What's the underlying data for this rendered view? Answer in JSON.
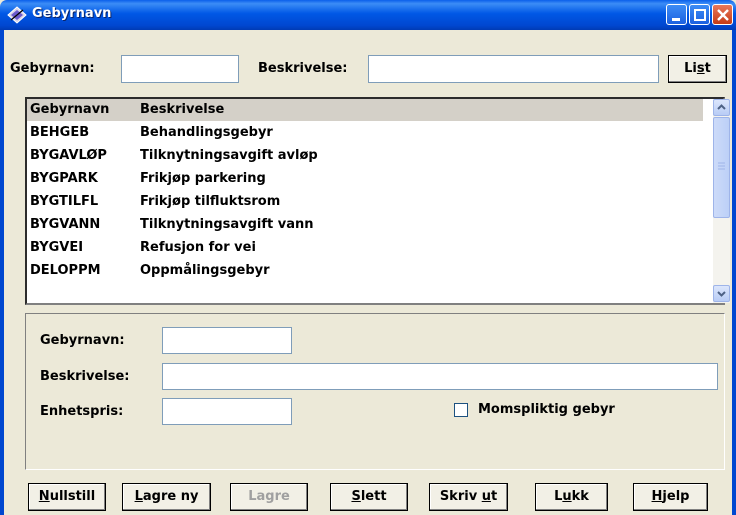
{
  "window": {
    "title": "Gebyrnavn",
    "icon": "app-diamond-icon"
  },
  "search": {
    "gebyrnavn_label": "Gebyrnavn:",
    "gebyrnavn_value": "",
    "beskrivelse_label": "Beskrivelse:",
    "beskrivelse_value": "",
    "list_label_pre": "Li",
    "list_label_u": "s",
    "list_label_post": "t"
  },
  "list": {
    "columns": [
      "Gebyrnavn",
      "Beskrivelse"
    ],
    "rows": [
      [
        "BEHGEB",
        "Behandlingsgebyr"
      ],
      [
        "BYGAVLØP",
        "Tilknytningsavgift avløp"
      ],
      [
        "BYGPARK",
        "Frikjøp parkering"
      ],
      [
        "BYGTILFL",
        "Frikjøp tilfluktsrom"
      ],
      [
        "BYGVANN",
        "Tilknytningsavgift vann"
      ],
      [
        "BYGVEI",
        "Refusjon for vei"
      ],
      [
        "DELOPPM",
        "Oppmålingsgebyr"
      ]
    ]
  },
  "detail": {
    "gebyrnavn_label": "Gebyrnavn:",
    "beskrivelse_label": "Beskrivelse:",
    "enhetspris_label": "Enhetspris:",
    "gebyrnavn_value": "",
    "beskrivelse_value": "",
    "enhetspris_value": "",
    "momspliktig_label": "Momspliktig gebyr",
    "momspliktig_checked": false
  },
  "buttons": {
    "nullstill": {
      "u": "N",
      "rest": "ullstill"
    },
    "lagre_ny": {
      "u": "L",
      "rest": "agre ny"
    },
    "lagre": {
      "pre": "Lagre"
    },
    "slett": {
      "u": "S",
      "rest": "lett"
    },
    "skriv_ut": {
      "pre": "Skriv ",
      "u": "u",
      "rest": "t"
    },
    "lukk": {
      "pre": "L",
      "u": "u",
      "rest": "kk"
    },
    "hjelp": {
      "u": "H",
      "rest": "jelp"
    }
  }
}
